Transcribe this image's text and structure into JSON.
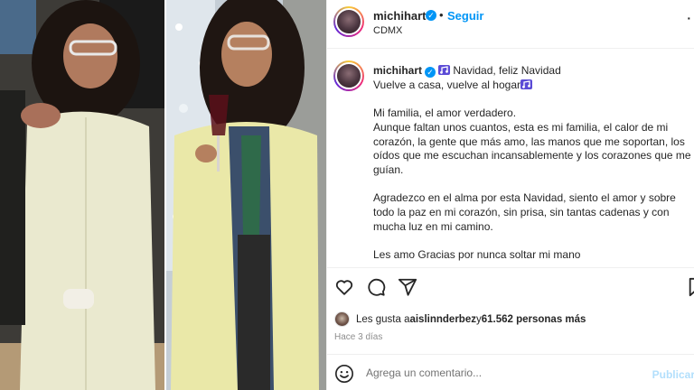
{
  "post": {
    "username": "michihart",
    "location": "CDMX",
    "follow_label": "Seguir",
    "separator": "•",
    "more_label": "·",
    "verified_glyph": "✓"
  },
  "caption": {
    "title_text": " Navidad, feliz Navidad",
    "line2": "Vuelve a casa, vuelve al hogar",
    "paragraph1_line1": "Mi familia, el amor verdadero.",
    "paragraph1_body": "Aunque faltan unos cuantos, esta es mi familia, el calor de mi corazón, la gente que más amo, las manos que me soportan, los oídos que me escuchan incansablemente y los corazones que me guían.",
    "paragraph2": "Agradezco en el alma por esta Navidad, siento el amor y sobre todo la paz en mi corazón, sin prisa, sin tantas cadenas y con mucha luz en mi camino.",
    "paragraph3": "Les amo Gracias por nunca soltar mi mano",
    "emoji_color": "#5b4bd6"
  },
  "likes": {
    "prefix": "Les gusta a ",
    "liker": "aislinnderbez",
    "connector": " y ",
    "count_text": "61.562 personas más"
  },
  "time_ago": "Hace 3 días",
  "comment": {
    "placeholder": "Agrega un comentario...",
    "publish_label": "Publicar"
  },
  "icons": [
    "heart-icon",
    "comment-icon",
    "share-icon",
    "bookmark-icon",
    "emoji-smile-icon"
  ],
  "colors": {
    "accent": "#0095f6",
    "publish_disabled": "#b2dffc",
    "muted": "#8e8e8e"
  }
}
